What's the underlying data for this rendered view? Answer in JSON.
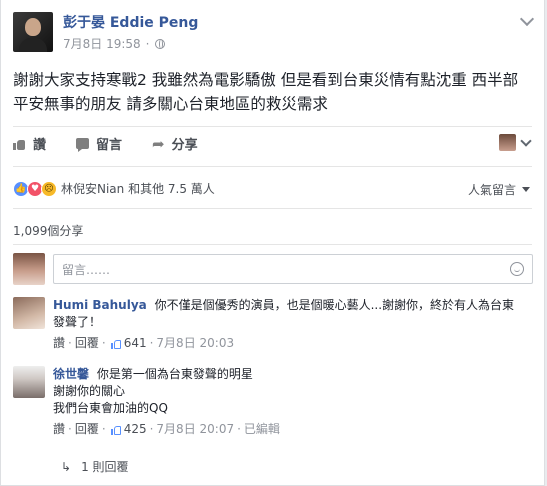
{
  "post": {
    "author": "彭于晏 Eddie Peng",
    "date": "7月8日 19:58",
    "separator": "·",
    "body": "謝謝大家支持寒戰2 我雖然為電影驕傲 但是看到台東災情有點沈重 西半部平安無事的朋友 請多關心台東地區的救災需求"
  },
  "actions": {
    "like": "讚",
    "comment": "留言",
    "share": "分享"
  },
  "reactions": {
    "text": "林倪安Nian 和其他 7.5 萬人"
  },
  "sort": {
    "label": "人氣留言"
  },
  "shares": {
    "text": "1,099個分享"
  },
  "composer": {
    "placeholder": "留言……"
  },
  "comments": [
    {
      "name": "Humi Bahulya",
      "text": "你不僅是個優秀的演員，也是個暖心藝人...謝謝你，終於有人為台東發聲了！",
      "like": "讚",
      "reply": "回覆",
      "likes": "641",
      "date": "7月8日 20:03"
    },
    {
      "name": "徐世馨",
      "line1": "你是第一個為台東發聲的明星",
      "line2": "謝謝你的關心",
      "line3": "我們台東會加油的QQ",
      "like": "讚",
      "reply": "回覆",
      "likes": "425",
      "date": "7月8日 20:07",
      "edited": "已編輯"
    }
  ],
  "replies": {
    "arrow": "↳",
    "text": "1 則回覆"
  },
  "colors": {
    "link": "#365899",
    "like_blue": "#5890ff",
    "love": "#f25268",
    "sad": "#f7b928"
  }
}
